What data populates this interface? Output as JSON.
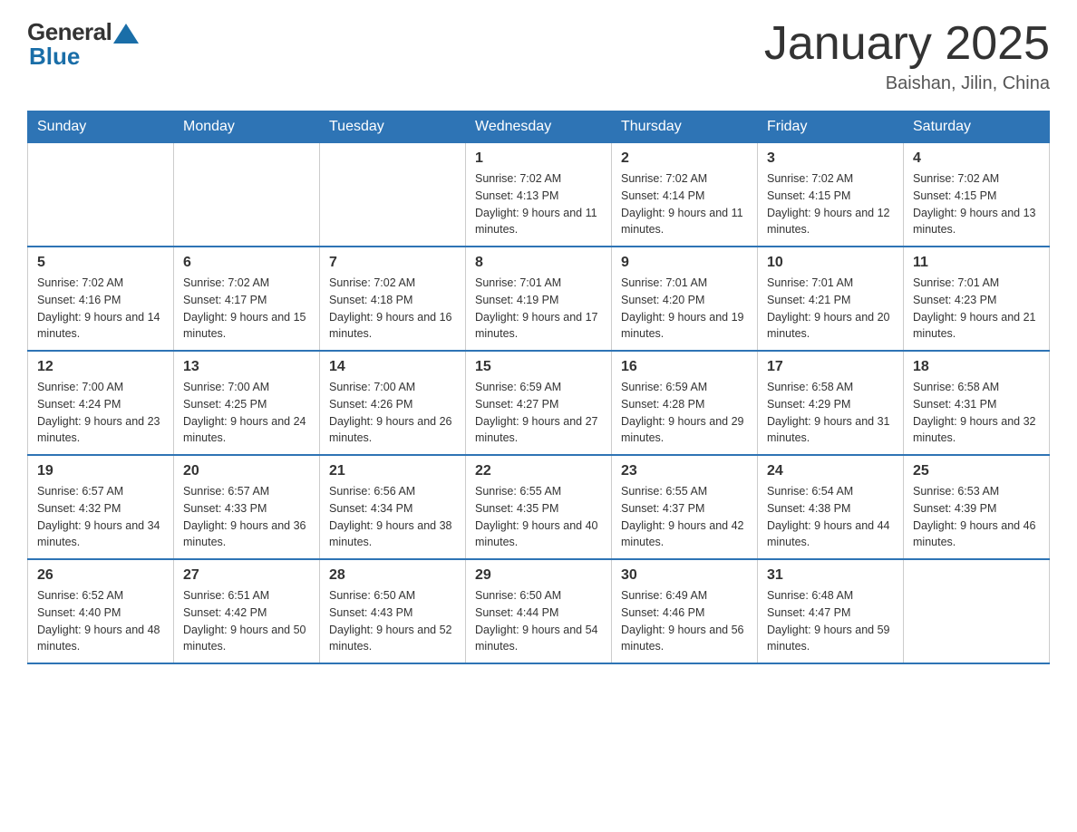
{
  "logo": {
    "general": "General",
    "blue": "Blue"
  },
  "header": {
    "month_year": "January 2025",
    "location": "Baishan, Jilin, China"
  },
  "days_of_week": [
    "Sunday",
    "Monday",
    "Tuesday",
    "Wednesday",
    "Thursday",
    "Friday",
    "Saturday"
  ],
  "weeks": [
    [
      {
        "day": "",
        "info": ""
      },
      {
        "day": "",
        "info": ""
      },
      {
        "day": "",
        "info": ""
      },
      {
        "day": "1",
        "info": "Sunrise: 7:02 AM\nSunset: 4:13 PM\nDaylight: 9 hours and 11 minutes."
      },
      {
        "day": "2",
        "info": "Sunrise: 7:02 AM\nSunset: 4:14 PM\nDaylight: 9 hours and 11 minutes."
      },
      {
        "day": "3",
        "info": "Sunrise: 7:02 AM\nSunset: 4:15 PM\nDaylight: 9 hours and 12 minutes."
      },
      {
        "day": "4",
        "info": "Sunrise: 7:02 AM\nSunset: 4:15 PM\nDaylight: 9 hours and 13 minutes."
      }
    ],
    [
      {
        "day": "5",
        "info": "Sunrise: 7:02 AM\nSunset: 4:16 PM\nDaylight: 9 hours and 14 minutes."
      },
      {
        "day": "6",
        "info": "Sunrise: 7:02 AM\nSunset: 4:17 PM\nDaylight: 9 hours and 15 minutes."
      },
      {
        "day": "7",
        "info": "Sunrise: 7:02 AM\nSunset: 4:18 PM\nDaylight: 9 hours and 16 minutes."
      },
      {
        "day": "8",
        "info": "Sunrise: 7:01 AM\nSunset: 4:19 PM\nDaylight: 9 hours and 17 minutes."
      },
      {
        "day": "9",
        "info": "Sunrise: 7:01 AM\nSunset: 4:20 PM\nDaylight: 9 hours and 19 minutes."
      },
      {
        "day": "10",
        "info": "Sunrise: 7:01 AM\nSunset: 4:21 PM\nDaylight: 9 hours and 20 minutes."
      },
      {
        "day": "11",
        "info": "Sunrise: 7:01 AM\nSunset: 4:23 PM\nDaylight: 9 hours and 21 minutes."
      }
    ],
    [
      {
        "day": "12",
        "info": "Sunrise: 7:00 AM\nSunset: 4:24 PM\nDaylight: 9 hours and 23 minutes."
      },
      {
        "day": "13",
        "info": "Sunrise: 7:00 AM\nSunset: 4:25 PM\nDaylight: 9 hours and 24 minutes."
      },
      {
        "day": "14",
        "info": "Sunrise: 7:00 AM\nSunset: 4:26 PM\nDaylight: 9 hours and 26 minutes."
      },
      {
        "day": "15",
        "info": "Sunrise: 6:59 AM\nSunset: 4:27 PM\nDaylight: 9 hours and 27 minutes."
      },
      {
        "day": "16",
        "info": "Sunrise: 6:59 AM\nSunset: 4:28 PM\nDaylight: 9 hours and 29 minutes."
      },
      {
        "day": "17",
        "info": "Sunrise: 6:58 AM\nSunset: 4:29 PM\nDaylight: 9 hours and 31 minutes."
      },
      {
        "day": "18",
        "info": "Sunrise: 6:58 AM\nSunset: 4:31 PM\nDaylight: 9 hours and 32 minutes."
      }
    ],
    [
      {
        "day": "19",
        "info": "Sunrise: 6:57 AM\nSunset: 4:32 PM\nDaylight: 9 hours and 34 minutes."
      },
      {
        "day": "20",
        "info": "Sunrise: 6:57 AM\nSunset: 4:33 PM\nDaylight: 9 hours and 36 minutes."
      },
      {
        "day": "21",
        "info": "Sunrise: 6:56 AM\nSunset: 4:34 PM\nDaylight: 9 hours and 38 minutes."
      },
      {
        "day": "22",
        "info": "Sunrise: 6:55 AM\nSunset: 4:35 PM\nDaylight: 9 hours and 40 minutes."
      },
      {
        "day": "23",
        "info": "Sunrise: 6:55 AM\nSunset: 4:37 PM\nDaylight: 9 hours and 42 minutes."
      },
      {
        "day": "24",
        "info": "Sunrise: 6:54 AM\nSunset: 4:38 PM\nDaylight: 9 hours and 44 minutes."
      },
      {
        "day": "25",
        "info": "Sunrise: 6:53 AM\nSunset: 4:39 PM\nDaylight: 9 hours and 46 minutes."
      }
    ],
    [
      {
        "day": "26",
        "info": "Sunrise: 6:52 AM\nSunset: 4:40 PM\nDaylight: 9 hours and 48 minutes."
      },
      {
        "day": "27",
        "info": "Sunrise: 6:51 AM\nSunset: 4:42 PM\nDaylight: 9 hours and 50 minutes."
      },
      {
        "day": "28",
        "info": "Sunrise: 6:50 AM\nSunset: 4:43 PM\nDaylight: 9 hours and 52 minutes."
      },
      {
        "day": "29",
        "info": "Sunrise: 6:50 AM\nSunset: 4:44 PM\nDaylight: 9 hours and 54 minutes."
      },
      {
        "day": "30",
        "info": "Sunrise: 6:49 AM\nSunset: 4:46 PM\nDaylight: 9 hours and 56 minutes."
      },
      {
        "day": "31",
        "info": "Sunrise: 6:48 AM\nSunset: 4:47 PM\nDaylight: 9 hours and 59 minutes."
      },
      {
        "day": "",
        "info": ""
      }
    ]
  ]
}
